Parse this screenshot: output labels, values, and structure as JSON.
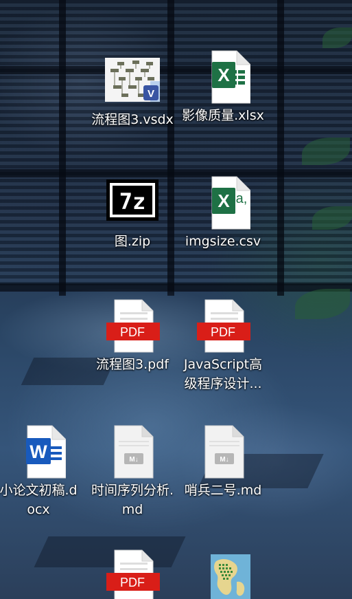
{
  "desktop": {
    "icons": [
      {
        "label": "流程图3.vsdx",
        "icon": "visio-file-icon"
      },
      {
        "label": "影像质量.xlsx",
        "icon": "excel-file-icon"
      },
      {
        "label": "图.zip",
        "icon": "7zip-archive-icon"
      },
      {
        "label": "imgsize.csv",
        "icon": "csv-file-icon"
      },
      {
        "label": "流程图3.pdf",
        "icon": "pdf-file-icon"
      },
      {
        "label": "JavaScript高级程序设计...",
        "icon": "pdf-file-icon"
      },
      {
        "label": "小论文初稿.docx",
        "icon": "word-file-icon"
      },
      {
        "label": "时间序列分析.md",
        "icon": "markdown-file-icon"
      },
      {
        "label": "哨兵二号.md",
        "icon": "markdown-file-icon"
      },
      {
        "label": "",
        "icon": "pdf-file-icon"
      },
      {
        "label": "",
        "icon": "map-image-icon"
      }
    ],
    "badges": {
      "pdf": "PDF",
      "zip": "7z",
      "word": "W",
      "excel": "X",
      "csv_glyph": "a,",
      "visio": "V",
      "md": "M↓"
    },
    "colors": {
      "pdf_red": "#d91e18",
      "excel_green": "#1e7145",
      "word_blue": "#185abd",
      "visio_blue": "#3955a3",
      "md_gray": "#b6b6b6"
    }
  }
}
